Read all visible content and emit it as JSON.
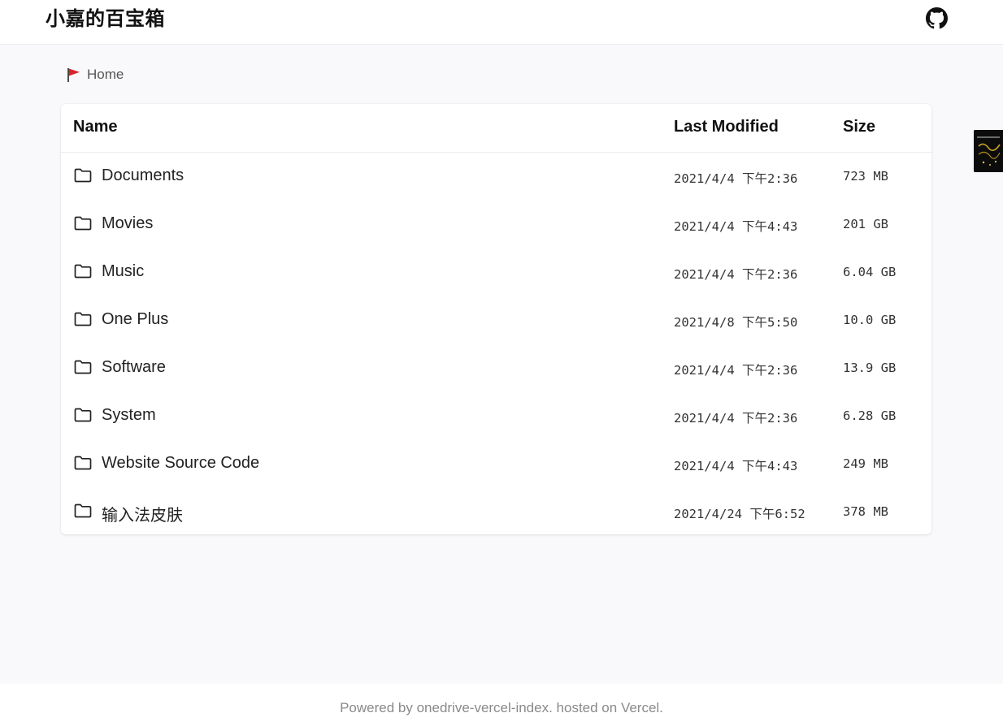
{
  "header": {
    "title": "小嘉的百宝箱",
    "github_icon": "github-icon"
  },
  "breadcrumb": {
    "icon": "red-flag-icon",
    "label": "Home"
  },
  "table": {
    "columns": [
      "Name",
      "Last Modified",
      "Size"
    ],
    "rows": [
      {
        "name": "Documents",
        "modified": "2021/4/4 下午2:36",
        "size": "723 MB",
        "icon": "folder-icon"
      },
      {
        "name": "Movies",
        "modified": "2021/4/4 下午4:43",
        "size": "201 GB",
        "icon": "folder-icon"
      },
      {
        "name": "Music",
        "modified": "2021/4/4 下午2:36",
        "size": "6.04 GB",
        "icon": "folder-icon"
      },
      {
        "name": "One Plus",
        "modified": "2021/4/8 下午5:50",
        "size": "10.0 GB",
        "icon": "folder-icon"
      },
      {
        "name": "Software",
        "modified": "2021/4/4 下午2:36",
        "size": "13.9 GB",
        "icon": "folder-icon"
      },
      {
        "name": "System",
        "modified": "2021/4/4 下午2:36",
        "size": "6.28 GB",
        "icon": "folder-icon"
      },
      {
        "name": "Website Source Code",
        "modified": "2021/4/4 下午4:43",
        "size": "249 MB",
        "icon": "folder-icon"
      },
      {
        "name": "输入法皮肤",
        "modified": "2021/4/24 下午6:52",
        "size": "378 MB",
        "icon": "folder-icon"
      }
    ]
  },
  "footer": {
    "text": "Powered by onedrive-vercel-index. hosted on Vercel."
  },
  "colors": {
    "flag": "#d7262b",
    "footer_text": "#8a8a8a",
    "background": "#f9f9fb"
  }
}
